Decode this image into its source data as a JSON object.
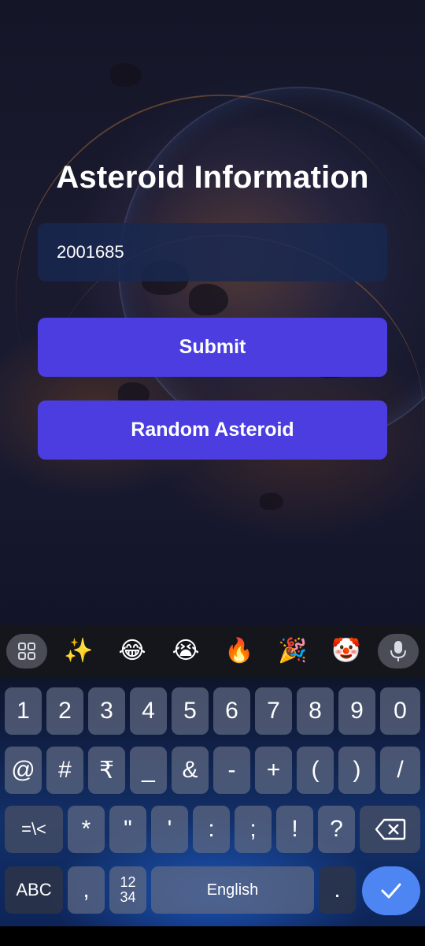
{
  "screen": {
    "title": "Asteroid Information",
    "input": {
      "value": "2001685"
    },
    "submit_label": "Submit",
    "random_label": "Random Asteroid"
  },
  "colors": {
    "button": "#4b3de0",
    "input_bg": "#19284f",
    "enter_key": "#4d86f2"
  },
  "keyboard": {
    "toolbar": {
      "menu_icon": "grid-icon",
      "emojis": [
        "✨",
        "😂",
        "😭",
        "🔥",
        "🎉",
        "🤡"
      ],
      "mic_icon": "mic-icon"
    },
    "row1": [
      "1",
      "2",
      "3",
      "4",
      "5",
      "6",
      "7",
      "8",
      "9",
      "0"
    ],
    "row2": [
      "@",
      "#",
      "₹",
      "_",
      "&",
      "-",
      "+",
      "(",
      ")",
      "/"
    ],
    "row3": [
      "=\\<",
      "*",
      "\"",
      "'",
      ":",
      ";",
      "!",
      "?"
    ],
    "row3_backspace_icon": "backspace-icon",
    "row4": {
      "abc": "ABC",
      "comma": ",",
      "numpad": "12\n34",
      "space": "English",
      "period": ".",
      "enter_icon": "checkmark-icon"
    }
  }
}
